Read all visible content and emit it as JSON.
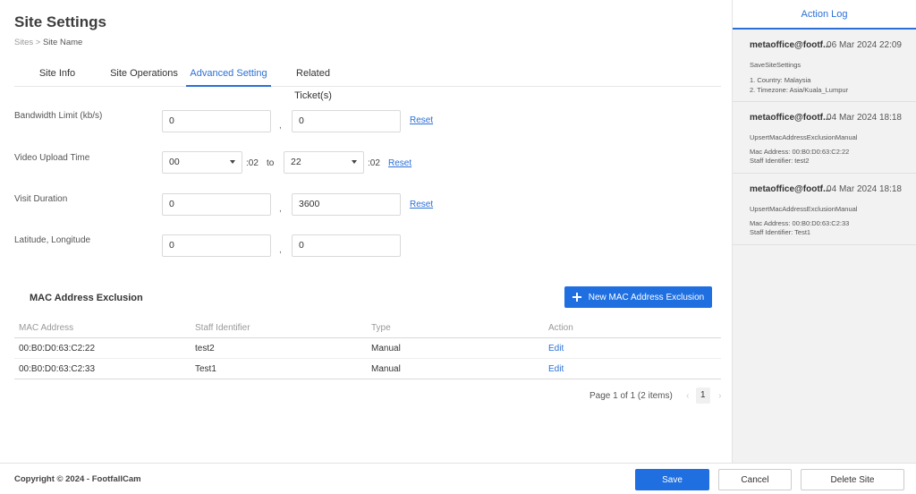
{
  "page": {
    "title": "Site Settings",
    "breadcrumb_parent": "Sites",
    "breadcrumb_sep": ">",
    "breadcrumb_current": "Site Name"
  },
  "tabs": [
    {
      "label": "Site Info",
      "active": false
    },
    {
      "label": "Site Operations",
      "active": false
    },
    {
      "label": "Advanced Setting",
      "active": true
    },
    {
      "label": "Related Ticket(s)",
      "active": false
    }
  ],
  "form": {
    "bandwidth": {
      "label": "Bandwidth Limit (kb/s)",
      "value1": "0",
      "separator": ",",
      "value2": "0",
      "reset": "Reset"
    },
    "video_upload": {
      "label": "Video Upload Time",
      "from_hour": "00",
      "from_suffix": ":02",
      "to_label": "to",
      "to_hour": "22",
      "to_suffix": ":02",
      "reset": "Reset"
    },
    "visit_duration": {
      "label": "Visit Duration",
      "value1": "0",
      "separator": ",",
      "value2": "3600",
      "reset": "Reset"
    },
    "lat_long": {
      "label": "Latitude, Longitude",
      "value1": "0",
      "separator": ",",
      "value2": "0"
    }
  },
  "mac_section": {
    "title": "MAC Address Exclusion",
    "new_button": "New MAC Address Exclusion",
    "columns": [
      "MAC Address",
      "Staff Identifier",
      "Type",
      "Action"
    ],
    "rows": [
      {
        "mac": "00:B0:D0:63:C2:22",
        "staff": "test2",
        "type": "Manual",
        "action": "Edit"
      },
      {
        "mac": "00:B0:D0:63:C2:33",
        "staff": "Test1",
        "type": "Manual",
        "action": "Edit"
      }
    ],
    "pagination": {
      "summary": "Page 1 of 1 (2 items)",
      "prev": "‹",
      "page": "1",
      "next": "›"
    }
  },
  "action_log": {
    "title": "Action Log",
    "entries": [
      {
        "user": "metaoffice@footf...",
        "date": "06 Mar 2024 22:09",
        "action": "SaveSiteSettings",
        "details": [
          "1. Country: Malaysia",
          "2. Timezone: Asia/Kuala_Lumpur"
        ]
      },
      {
        "user": "metaoffice@footf...",
        "date": "04 Mar 2024 18:18",
        "action": "UpsertMacAddressExclusionManual",
        "details": [
          "Mac Address: 00:B0:D0:63:C2:22",
          "Staff Identifier: test2"
        ]
      },
      {
        "user": "metaoffice@footf...",
        "date": "04 Mar 2024 18:18",
        "action": "UpsertMacAddressExclusionManual",
        "details": [
          "Mac Address: 00:B0:D0:63:C2:33",
          "Staff Identifier: Test1"
        ]
      }
    ]
  },
  "footer": {
    "copyright": "Copyright © 2024 - FootfallCam",
    "save": "Save",
    "cancel": "Cancel",
    "delete": "Delete Site"
  },
  "colors": {
    "accent": "#1f6fe0",
    "link": "#2b6fd6",
    "panel_bg": "#f2f2f2"
  }
}
